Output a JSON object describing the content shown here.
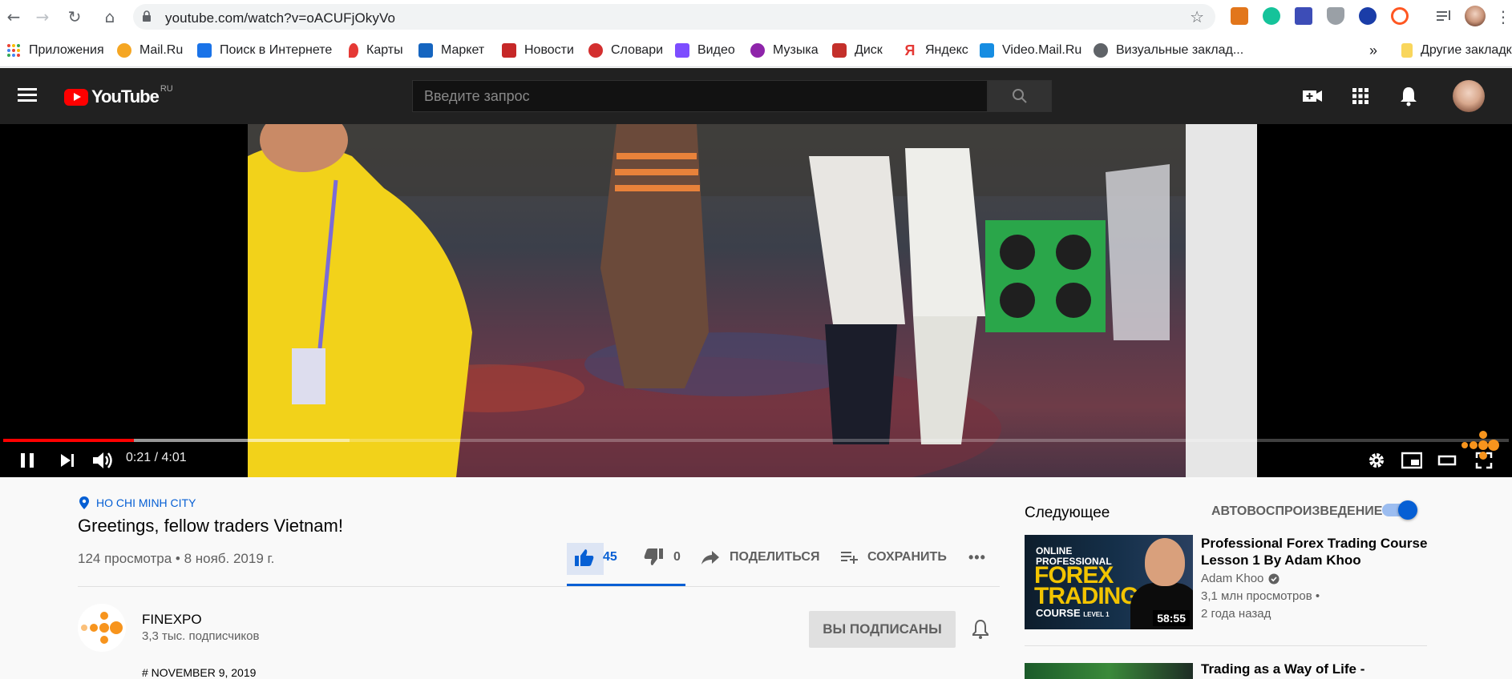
{
  "browser": {
    "url": "youtube.com/watch?v=oACUFjOkyVo",
    "bookmarks": [
      {
        "label": "Приложения",
        "color": "#ea4335"
      },
      {
        "label": "Mail.Ru",
        "color": "#f5a623"
      },
      {
        "label": "Поиск в Интернете",
        "color": "#1a73e8"
      },
      {
        "label": "Карты",
        "color": "#e53935"
      },
      {
        "label": "Маркет",
        "color": "#1565c0"
      },
      {
        "label": "Новости",
        "color": "#c62828"
      },
      {
        "label": "Словари",
        "color": "#d32f2f"
      },
      {
        "label": "Видео",
        "color": "#7c4dff"
      },
      {
        "label": "Музыка",
        "color": "#8e24aa"
      },
      {
        "label": "Диск",
        "color": "#c4302b"
      },
      {
        "label": "Яндекс",
        "color": "#e53935"
      },
      {
        "label": "Video.Mail.Ru",
        "color": "#168de2"
      },
      {
        "label": "Визуальные заклад...",
        "color": "#5f6368"
      }
    ],
    "bookmarks_more": "»",
    "other_bookmarks": "Другие закладки"
  },
  "youtube": {
    "logo_text": "YouTube",
    "logo_region": "RU",
    "search_placeholder": "Введите запрос",
    "player": {
      "time": "0:21 / 4:01",
      "progress_played_fraction": 0.087,
      "progress_buffered_fraction": 0.23
    },
    "video": {
      "location": "HO CHI MINH CITY",
      "title": "Greetings, fellow traders Vietnam!",
      "info": "124 просмотра • 8 нояб. 2019 г.",
      "likes": "45",
      "dislikes": "0",
      "share_label": "ПОДЕЛИТЬСЯ",
      "save_label": "СОХРАНИТЬ",
      "more_label": "•••"
    },
    "channel": {
      "name": "FINEXPO",
      "subscribers": "3,3 тыс. подписчиков",
      "subscribe_label": "ВЫ ПОДПИСАНЫ",
      "description_peek": "# NOVEMBER 9, 2019"
    },
    "sidebar": {
      "next_label": "Следующее",
      "autoplay_label": "АВТОВОСПРОИЗВЕДЕНИЕ",
      "autoplay_on": true,
      "videos": [
        {
          "title": "Professional Forex Trading Course Lesson 1 By Adam Khoo",
          "channel": "Adam Khoo",
          "views": "3,1 млн просмотров •",
          "ago": "2 года назад",
          "duration": "58:55",
          "thumb_line1": "ONLINE",
          "thumb_line2": "PROFESSIONAL",
          "thumb_line3": "FOREX",
          "thumb_line4": "TRADING",
          "thumb_line5": "COURSE",
          "thumb_level": "LEVEL 1"
        },
        {
          "title": "Trading as a Way of Life -"
        }
      ]
    }
  }
}
